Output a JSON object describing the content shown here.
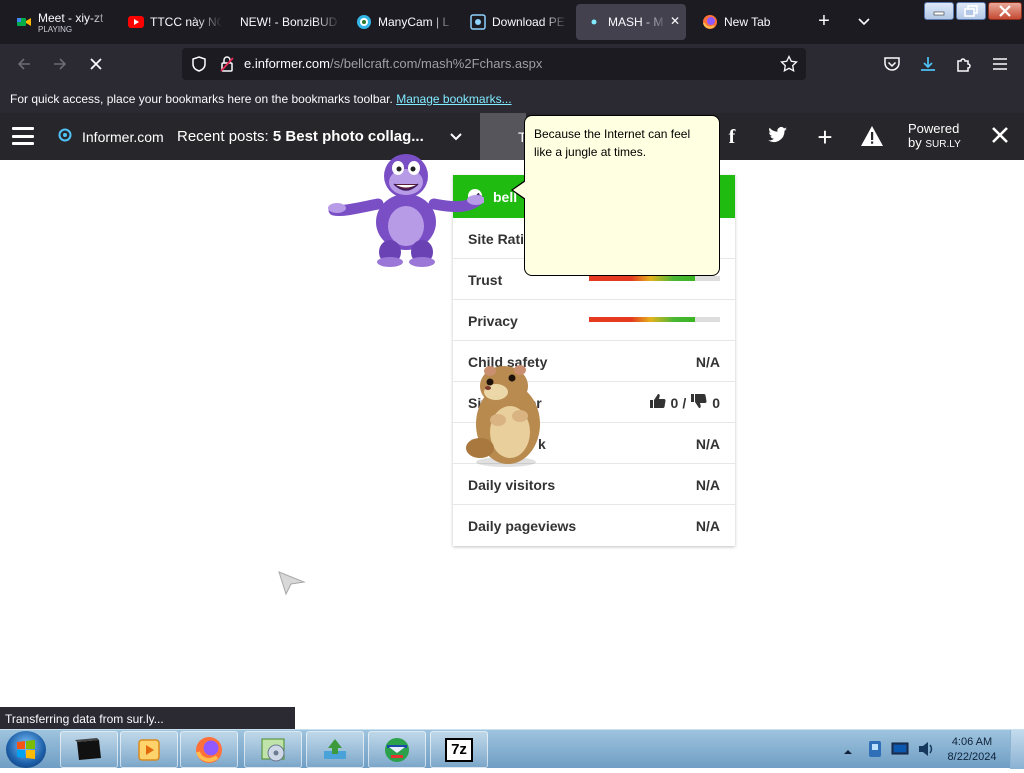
{
  "browser": {
    "tabs": [
      {
        "title": "Meet - xiy-zt",
        "subtitle": "PLAYING",
        "icon": "google-meet-icon"
      },
      {
        "title": "TTCC này NG",
        "icon": "youtube-icon"
      },
      {
        "title": "NEW! - BonziBUD",
        "icon": "none"
      },
      {
        "title": "ManyCam | L",
        "icon": "manycam-icon"
      },
      {
        "title": "Download PE",
        "icon": "download-site-icon"
      },
      {
        "title": "MASH - M",
        "icon": "loading-dot-icon",
        "active": true
      },
      {
        "title": "New Tab",
        "icon": "firefox-icon"
      }
    ],
    "url_prefix": "e.informer.com",
    "url_path": "/s/bellcraft.com/mash%2Fchars.aspx",
    "bookmarks_text": "For quick access, place your bookmarks here on the bookmarks toolbar.",
    "bookmarks_link": "Manage bookmarks...",
    "status_text": "Transferring data from sur.ly..."
  },
  "informer_bar": {
    "brand": "Informer.com",
    "recent_label": "Recent posts:",
    "recent_post": "5 Best photo collag...",
    "grey_text": "T",
    "powered_line1": "Powered",
    "powered_line2": "by",
    "powered_brand": "SUR.LY"
  },
  "panel": {
    "header": "bell",
    "rows": [
      {
        "label": "Site Rati",
        "value": ""
      },
      {
        "label": "Trust",
        "bar": 0.81
      },
      {
        "label": "Privacy",
        "bar": 0.81
      },
      {
        "label": "Child safety",
        "value": "N/A"
      },
      {
        "label": "Site",
        "label2": "or",
        "up": "0",
        "sep": "/",
        "down": "0"
      },
      {
        "label": "Al",
        "label2": "k",
        "value": "N/A"
      },
      {
        "label": "Daily visitors",
        "value": "N/A"
      },
      {
        "label": "Daily pageviews",
        "value": "N/A"
      }
    ]
  },
  "balloon": {
    "text": "Because the Internet can feel like a jungle at times."
  },
  "taskbar": {
    "time": "4:06 AM",
    "date": "8/22/2024",
    "apps": [
      "terminal-app",
      "media-player",
      "firefox",
      "installer",
      "uploader",
      "download-manager",
      "7zip"
    ],
    "sevenzip_label": "7z"
  },
  "colors": {
    "panel_header": "#1fbb11",
    "balloon_bg": "#ffffe1",
    "bar_red": "#e53a1f",
    "bar_green": "#3ab521"
  }
}
